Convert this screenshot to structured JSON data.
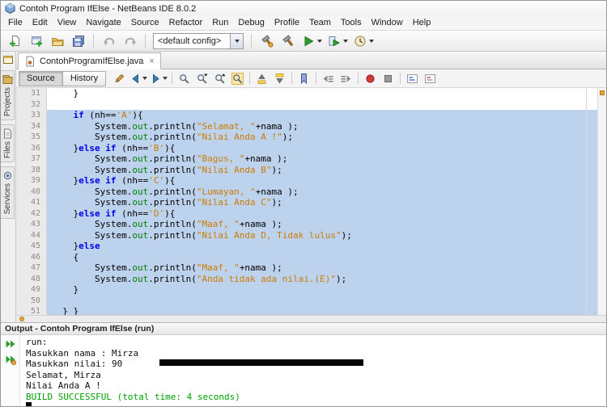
{
  "window": {
    "title": "Contoh Program IfElse - NetBeans IDE 8.0.2"
  },
  "menubar": {
    "items": [
      "File",
      "Edit",
      "View",
      "Navigate",
      "Source",
      "Refactor",
      "Run",
      "Debug",
      "Profile",
      "Team",
      "Tools",
      "Window",
      "Help"
    ]
  },
  "toolbar": {
    "file_icons": [
      "new-file",
      "new-project",
      "open-project",
      "save-all"
    ],
    "edit_icons": [
      "undo",
      "redo"
    ],
    "config_dropdown": "<default config>",
    "build_icons": [
      "clean-build",
      "build"
    ],
    "run_icons": [
      "run",
      "debug",
      "profile"
    ]
  },
  "sidebar": {
    "tabs": [
      {
        "icon": "projects",
        "label": "Projects"
      },
      {
        "icon": "files",
        "label": "Files"
      },
      {
        "icon": "services",
        "label": "Services"
      }
    ]
  },
  "editor": {
    "tab": {
      "label": "ContohProgramIfElse.java",
      "close": "×"
    },
    "view_buttons": [
      "Source",
      "History"
    ],
    "toolbar_groups": [
      [
        "last-edit",
        "back",
        "forward"
      ],
      [
        "find-selection",
        "find-next",
        "find-previous",
        "toggle-highlight"
      ],
      [
        "previous-occurrence",
        "next-occurrence"
      ],
      [
        "toggle-bookmark"
      ],
      [
        "shift-left",
        "shift-right"
      ],
      [
        "start-macro",
        "stop-macro"
      ],
      [
        "comment",
        "uncomment"
      ]
    ],
    "code_lines": [
      {
        "n": "31",
        "sel": false,
        "toks": [
          [
            "pl",
            "    }"
          ]
        ]
      },
      {
        "n": "32",
        "sel": false,
        "toks": []
      },
      {
        "n": "33",
        "sel": true,
        "toks": [
          [
            "pl",
            "    "
          ],
          [
            "kw",
            "if"
          ],
          [
            "pl",
            " (nh=="
          ],
          [
            "str",
            "'A'"
          ],
          [
            "pl",
            "){"
          ]
        ]
      },
      {
        "n": "34",
        "sel": true,
        "toks": [
          [
            "pl",
            "        System."
          ],
          [
            "fld",
            "out"
          ],
          [
            "pl",
            ".println("
          ],
          [
            "str",
            "\"Selamat, \""
          ],
          [
            "pl",
            "+nama );"
          ]
        ]
      },
      {
        "n": "35",
        "sel": true,
        "toks": [
          [
            "pl",
            "        System."
          ],
          [
            "fld",
            "out"
          ],
          [
            "pl",
            ".println("
          ],
          [
            "str",
            "\"Nilai Anda A !\""
          ],
          [
            "pl",
            ");"
          ]
        ]
      },
      {
        "n": "36",
        "sel": true,
        "toks": [
          [
            "pl",
            "    }"
          ],
          [
            "kw",
            "else"
          ],
          [
            "pl",
            " "
          ],
          [
            "kw",
            "if"
          ],
          [
            "pl",
            " (nh=="
          ],
          [
            "str",
            "'B'"
          ],
          [
            "pl",
            "){"
          ]
        ]
      },
      {
        "n": "37",
        "sel": true,
        "toks": [
          [
            "pl",
            "        System."
          ],
          [
            "fld",
            "out"
          ],
          [
            "pl",
            ".println("
          ],
          [
            "str",
            "\"Bagus, \""
          ],
          [
            "pl",
            "+nama );"
          ]
        ]
      },
      {
        "n": "38",
        "sel": true,
        "toks": [
          [
            "pl",
            "        System."
          ],
          [
            "fld",
            "out"
          ],
          [
            "pl",
            ".println("
          ],
          [
            "str",
            "\"Nilai Anda B\""
          ],
          [
            "pl",
            ");"
          ]
        ]
      },
      {
        "n": "39",
        "sel": true,
        "toks": [
          [
            "pl",
            "    }"
          ],
          [
            "kw",
            "else"
          ],
          [
            "pl",
            " "
          ],
          [
            "kw",
            "if"
          ],
          [
            "pl",
            " (nh=="
          ],
          [
            "str",
            "'C'"
          ],
          [
            "pl",
            "){"
          ]
        ]
      },
      {
        "n": "40",
        "sel": true,
        "toks": [
          [
            "pl",
            "        System."
          ],
          [
            "fld",
            "out"
          ],
          [
            "pl",
            ".println("
          ],
          [
            "str",
            "\"Lumayan, \""
          ],
          [
            "pl",
            "+nama );"
          ]
        ]
      },
      {
        "n": "41",
        "sel": true,
        "toks": [
          [
            "pl",
            "        System."
          ],
          [
            "fld",
            "out"
          ],
          [
            "pl",
            ".println("
          ],
          [
            "str",
            "\"Nilai Anda C\""
          ],
          [
            "pl",
            ");"
          ]
        ]
      },
      {
        "n": "42",
        "sel": true,
        "toks": [
          [
            "pl",
            "    }"
          ],
          [
            "kw",
            "else"
          ],
          [
            "pl",
            " "
          ],
          [
            "kw",
            "if"
          ],
          [
            "pl",
            " (nh=="
          ],
          [
            "str",
            "'D'"
          ],
          [
            "pl",
            "){"
          ]
        ]
      },
      {
        "n": "43",
        "sel": true,
        "toks": [
          [
            "pl",
            "        System."
          ],
          [
            "fld",
            "out"
          ],
          [
            "pl",
            ".println("
          ],
          [
            "str",
            "\"Maaf, \""
          ],
          [
            "pl",
            "+nama );"
          ]
        ]
      },
      {
        "n": "44",
        "sel": true,
        "toks": [
          [
            "pl",
            "        System."
          ],
          [
            "fld",
            "out"
          ],
          [
            "pl",
            ".println("
          ],
          [
            "str",
            "\"Nilai Anda D, Tidak lulus\""
          ],
          [
            "pl",
            ");"
          ]
        ]
      },
      {
        "n": "45",
        "sel": true,
        "toks": [
          [
            "pl",
            "    }"
          ],
          [
            "kw",
            "else"
          ]
        ]
      },
      {
        "n": "46",
        "sel": true,
        "toks": [
          [
            "pl",
            "    {"
          ]
        ]
      },
      {
        "n": "47",
        "sel": true,
        "toks": [
          [
            "pl",
            "        System."
          ],
          [
            "fld",
            "out"
          ],
          [
            "pl",
            ".println("
          ],
          [
            "str",
            "\"Maaf, \""
          ],
          [
            "pl",
            "+nama );"
          ]
        ]
      },
      {
        "n": "48",
        "sel": true,
        "toks": [
          [
            "pl",
            "        System."
          ],
          [
            "fld",
            "out"
          ],
          [
            "pl",
            ".println("
          ],
          [
            "str",
            "\"Anda tidak ada nilai.(E)\""
          ],
          [
            "pl",
            ");"
          ]
        ]
      },
      {
        "n": "49",
        "sel": true,
        "toks": [
          [
            "pl",
            "    }"
          ]
        ]
      },
      {
        "n": "50",
        "sel": true,
        "toks": []
      },
      {
        "n": "51",
        "sel": true,
        "toks": [
          [
            "pl",
            "  } }"
          ]
        ]
      }
    ]
  },
  "output": {
    "title": "Output - Contoh Program IfElse (run)",
    "rail_icons": [
      "rerun",
      "rerun-modified"
    ],
    "lines": [
      {
        "style": "plain",
        "text": "run:"
      },
      {
        "style": "plain",
        "text": "Masukkan nama : Mirza"
      },
      {
        "style": "plain",
        "text": "Masukkan nilai: 90"
      },
      {
        "style": "plain",
        "text": "Selamat, Mirza"
      },
      {
        "style": "plain",
        "text": "Nilai Anda A !"
      },
      {
        "style": "success",
        "text": "BUILD SUCCESSFUL (total time: 4 seconds)"
      }
    ]
  },
  "colors": {
    "selection": "#bdd2ec",
    "keyword": "#0000e6",
    "string": "#ce7b00",
    "field": "#008000",
    "success": "#00a000"
  }
}
